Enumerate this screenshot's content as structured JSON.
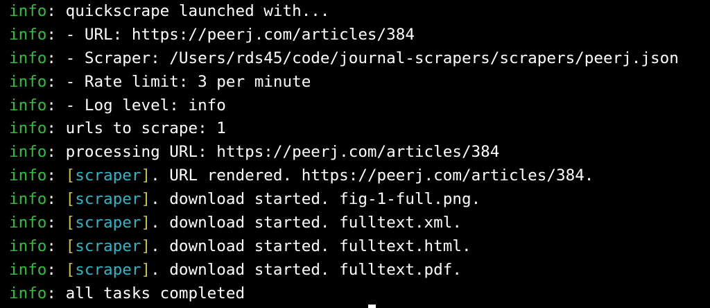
{
  "terminal": {
    "level_color": "#2ec03a",
    "bracket_color": "#c9c23a",
    "tag_color": "#2fb6c6",
    "text_color": "#ffffff",
    "background": "#000000",
    "lines": [
      {
        "level": "info",
        "sep": ": ",
        "tag": "",
        "message": "quickscrape launched with..."
      },
      {
        "level": "info",
        "sep": ": ",
        "tag": "",
        "message": "- URL: https://peerj.com/articles/384"
      },
      {
        "level": "info",
        "sep": ": ",
        "tag": "",
        "message": "- Scraper: /Users/rds45/code/journal-scrapers/scrapers/peerj.json"
      },
      {
        "level": "info",
        "sep": ": ",
        "tag": "",
        "message": "- Rate limit: 3 per minute"
      },
      {
        "level": "info",
        "sep": ": ",
        "tag": "",
        "message": "- Log level: info"
      },
      {
        "level": "info",
        "sep": ": ",
        "tag": "",
        "message": "urls to scrape: 1"
      },
      {
        "level": "info",
        "sep": ": ",
        "tag": "",
        "message": "processing URL: https://peerj.com/articles/384"
      },
      {
        "level": "info",
        "sep": ": ",
        "tag": "scraper",
        "message": ". URL rendered. https://peerj.com/articles/384."
      },
      {
        "level": "info",
        "sep": ": ",
        "tag": "scraper",
        "message": ". download started. fig-1-full.png."
      },
      {
        "level": "info",
        "sep": ": ",
        "tag": "scraper",
        "message": ". download started. fulltext.xml."
      },
      {
        "level": "info",
        "sep": ": ",
        "tag": "scraper",
        "message": ". download started. fulltext.html."
      },
      {
        "level": "info",
        "sep": ": ",
        "tag": "scraper",
        "message": ". download started. fulltext.pdf."
      },
      {
        "level": "info",
        "sep": ": ",
        "tag": "",
        "message": "all tasks completed"
      }
    ]
  }
}
